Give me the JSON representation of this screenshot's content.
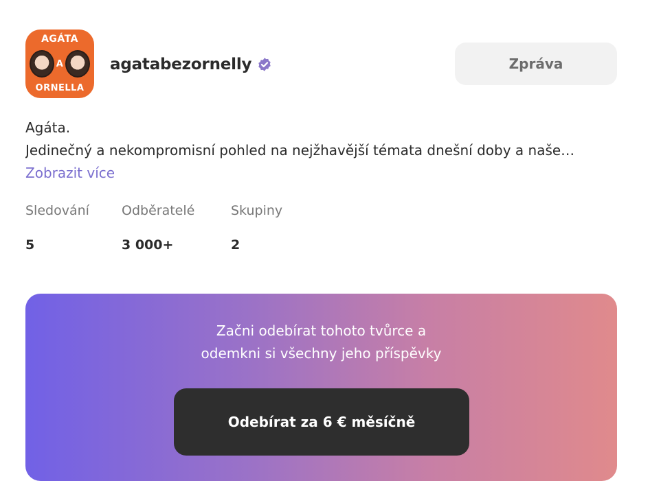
{
  "profile": {
    "avatar": {
      "logo_line1": "AGÁTA",
      "logo_line2": "A",
      "logo_line3": "ORNELLA",
      "background_color": "#ec6a2c"
    },
    "username": "agatabezornelly",
    "verified_icon": "verified-badge-icon",
    "message_button_label": "Zpráva"
  },
  "bio": {
    "line1": "Agáta.",
    "line2": "Jedinečný a nekompromisní pohled na nejžhavější témata dnešní doby a naše…",
    "show_more_label": "Zobrazit více",
    "link_color": "#7b6fcf"
  },
  "stats": [
    {
      "label": "Sledování",
      "value": "5"
    },
    {
      "label": "Odběratelé",
      "value": "3 000+"
    },
    {
      "label": "Skupiny",
      "value": "2"
    }
  ],
  "subscribe": {
    "promo_line1": "Začni odebírat tohoto tvůrce a",
    "promo_line2": "odemkni si všechny jeho příspěvky",
    "button_label": "Odebírat za 6 € měsíčně",
    "gradient_colors": [
      "#7161e6",
      "#9b72c7",
      "#c77fa6",
      "#e08a8c"
    ],
    "button_color": "#2e2e2e"
  }
}
